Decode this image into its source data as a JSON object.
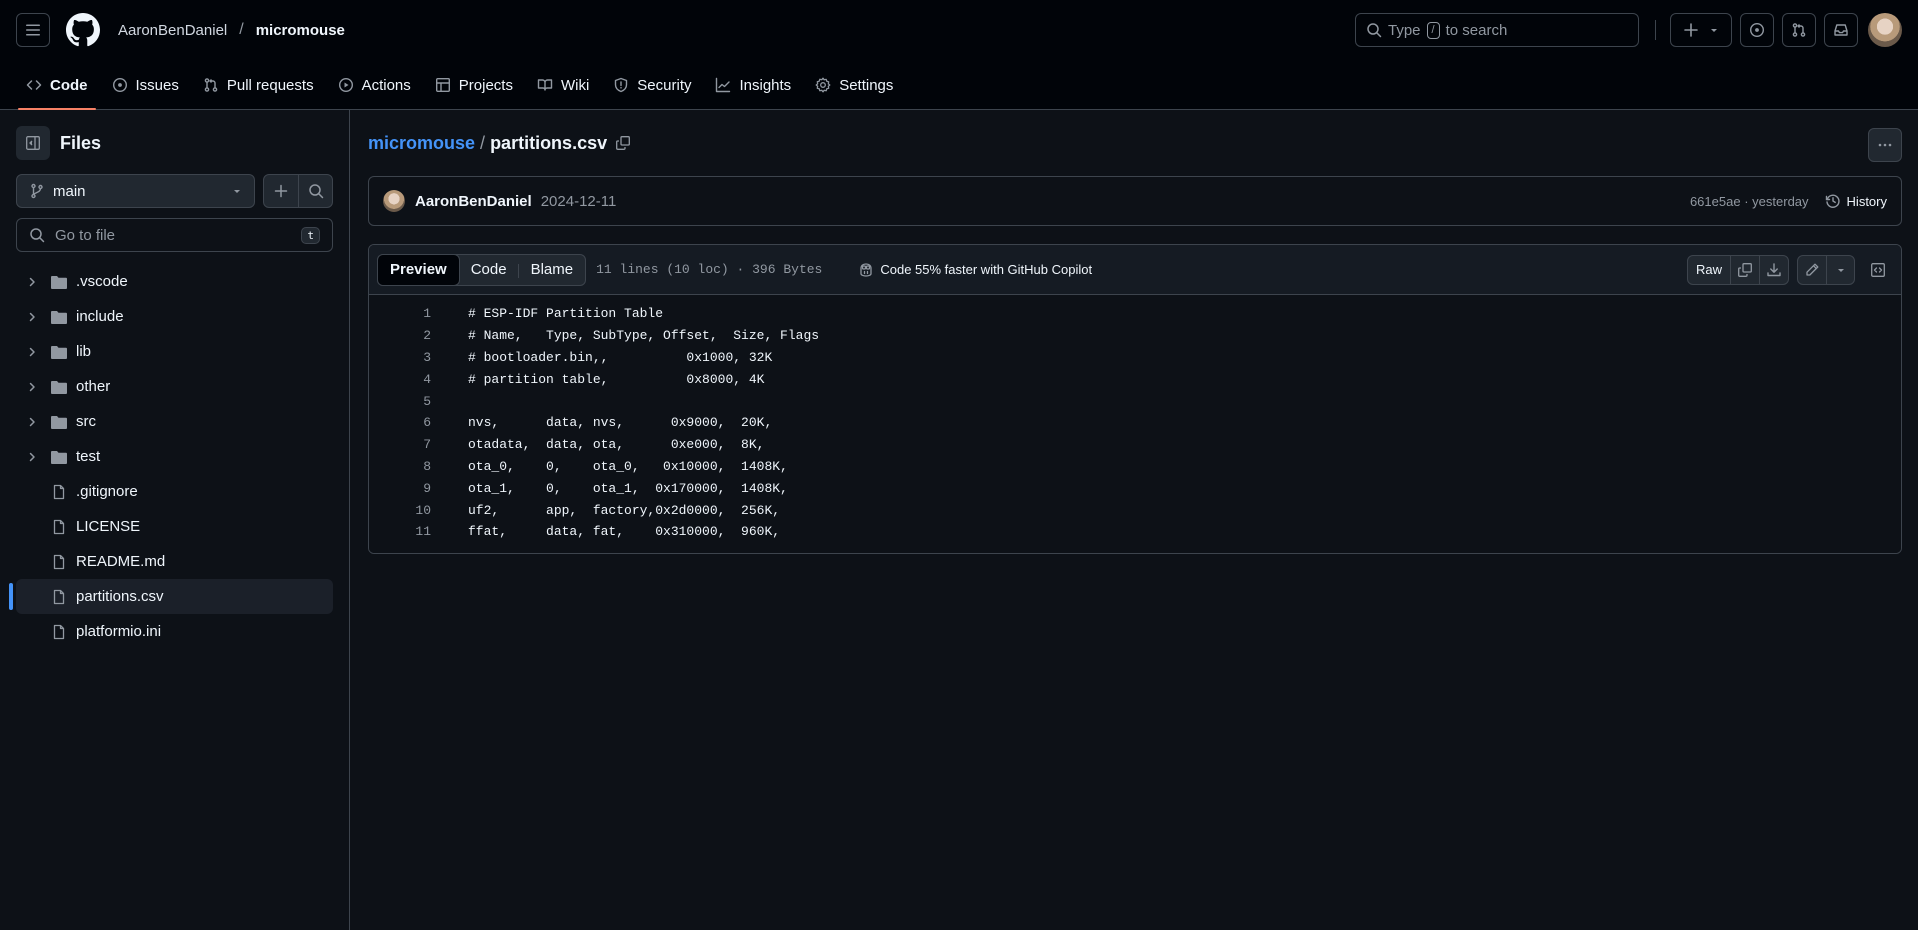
{
  "header": {
    "owner": "AaronBenDaniel",
    "separator": "/",
    "repo": "micromouse",
    "search": {
      "prefix": "Type",
      "key": "/",
      "suffix": "to search"
    }
  },
  "repo_tabs": [
    {
      "label": "Code",
      "icon": "code-icon",
      "active": true
    },
    {
      "label": "Issues",
      "icon": "issue-icon"
    },
    {
      "label": "Pull requests",
      "icon": "pull-request-icon"
    },
    {
      "label": "Actions",
      "icon": "play-icon"
    },
    {
      "label": "Projects",
      "icon": "table-icon"
    },
    {
      "label": "Wiki",
      "icon": "book-icon"
    },
    {
      "label": "Security",
      "icon": "shield-icon"
    },
    {
      "label": "Insights",
      "icon": "graph-icon"
    },
    {
      "label": "Settings",
      "icon": "gear-icon"
    }
  ],
  "sidebar": {
    "title": "Files",
    "branch": "main",
    "goto_placeholder": "Go to file",
    "goto_shortcut": "t",
    "items": [
      {
        "name": ".vscode",
        "type": "folder"
      },
      {
        "name": "include",
        "type": "folder"
      },
      {
        "name": "lib",
        "type": "folder"
      },
      {
        "name": "other",
        "type": "folder"
      },
      {
        "name": "src",
        "type": "folder"
      },
      {
        "name": "test",
        "type": "folder"
      },
      {
        "name": ".gitignore",
        "type": "file"
      },
      {
        "name": "LICENSE",
        "type": "file"
      },
      {
        "name": "README.md",
        "type": "file"
      },
      {
        "name": "partitions.csv",
        "type": "file",
        "selected": true
      },
      {
        "name": "platformio.ini",
        "type": "file"
      }
    ]
  },
  "file_path": {
    "repo": "micromouse",
    "separator": "/",
    "file": "partitions.csv"
  },
  "commit": {
    "author": "AaronBenDaniel",
    "date": "2024-12-11",
    "sha": "661e5ae",
    "dot": "·",
    "relative_time": "yesterday",
    "history_label": "History"
  },
  "file_view": {
    "tabs": [
      "Preview",
      "Code",
      "Blame"
    ],
    "active_tab": "Preview",
    "meta": "11 lines (10 loc) · 396 Bytes",
    "copilot_text": "Code 55% faster with GitHub Copilot",
    "raw_label": "Raw"
  },
  "code_lines": [
    "# ESP-IDF Partition Table",
    "# Name,   Type, SubType, Offset,  Size, Flags",
    "# bootloader.bin,,          0x1000, 32K",
    "# partition table,          0x8000, 4K",
    "",
    "nvs,      data, nvs,      0x9000,  20K,",
    "otadata,  data, ota,      0xe000,  8K,",
    "ota_0,    0,    ota_0,   0x10000,  1408K,",
    "ota_1,    0,    ota_1,  0x170000,  1408K,",
    "uf2,      app,  factory,0x2d0000,  256K,",
    "ffat,     data, fat,    0x310000,  960K,"
  ],
  "colors": {
    "accent_link": "#4493f8",
    "active_tab_underline": "#f78166",
    "background": "#0d1117",
    "header_background": "#010409"
  }
}
